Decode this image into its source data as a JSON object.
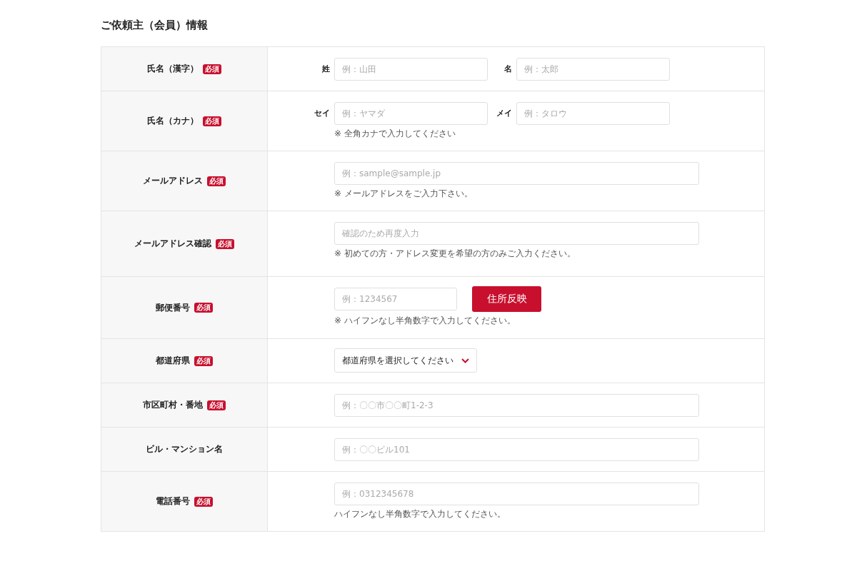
{
  "section_title": "ご依頼主（会員）情報",
  "rows": [
    {
      "kind": "name_pair",
      "label": "氏名（漢字）",
      "required": true,
      "required_badge": "必須",
      "fields": [
        {
          "label": "姓",
          "placeholder": "例：山田"
        },
        {
          "label": "名",
          "placeholder": "例：太郎"
        }
      ]
    },
    {
      "kind": "name_pair",
      "label": "氏名（カナ）",
      "required": true,
      "required_badge": "必須",
      "fields": [
        {
          "label": "セイ",
          "placeholder": "例：ヤマダ"
        },
        {
          "label": "メイ",
          "placeholder": "例：タロウ"
        }
      ],
      "hint": "※ 全角カナで入力してください"
    },
    {
      "kind": "text",
      "label": "メールアドレス",
      "required": true,
      "required_badge": "必須",
      "placeholder": "例：sample@sample.jp",
      "hint": "※ メールアドレスをご入力下さい。"
    },
    {
      "kind": "text",
      "label": "メールアドレス確認",
      "required": true,
      "required_badge": "必須",
      "placeholder": "確認のため再度入力",
      "hint": "※ 初めての方・アドレス変更を希望の方のみご入力ください。"
    },
    {
      "kind": "postal",
      "label": "郵便番号",
      "required": true,
      "required_badge": "必須",
      "placeholder": "例：1234567",
      "button": "住所反映",
      "hint": "※ ハイフンなし半角数字で入力してください。"
    },
    {
      "kind": "select",
      "label": "都道府県",
      "required": true,
      "required_badge": "必須",
      "value": "都道府県を選択してください"
    },
    {
      "kind": "text",
      "label": "市区町村・番地",
      "required": true,
      "required_badge": "必須",
      "placeholder": "例：〇〇市〇〇町1-2-3"
    },
    {
      "kind": "text",
      "label": "ビル・マンション名",
      "required": false,
      "placeholder": "例：〇〇ビル101"
    },
    {
      "kind": "text",
      "label": "電話番号",
      "required": true,
      "required_badge": "必須",
      "placeholder": "例：0312345678",
      "hint": "ハイフンなし半角数字で入力してください。"
    }
  ]
}
